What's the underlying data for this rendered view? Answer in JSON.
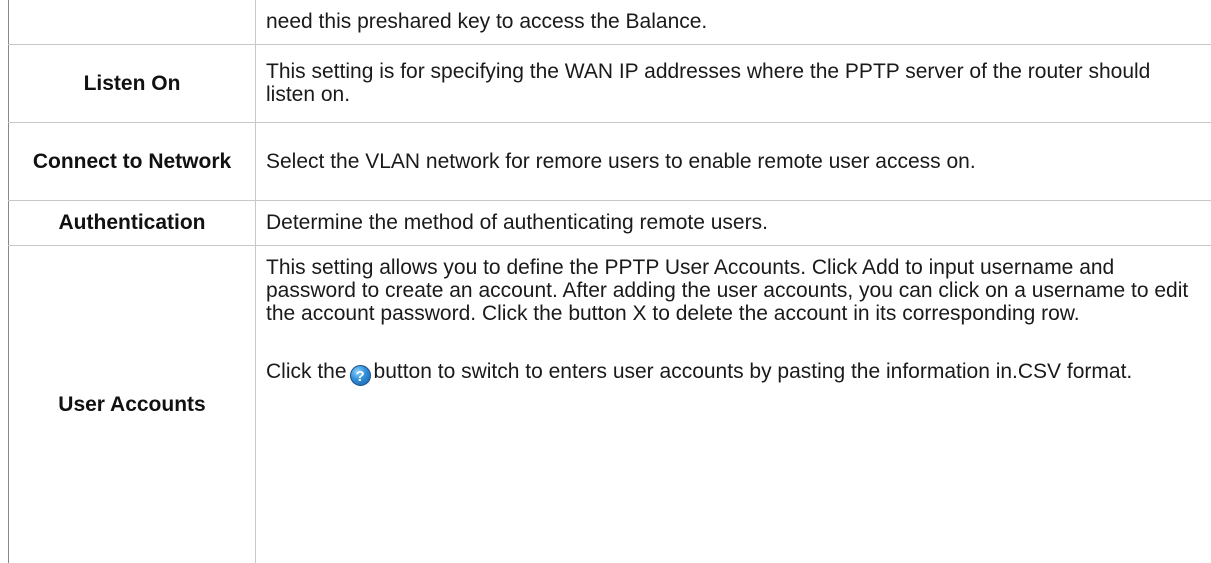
{
  "rows": [
    {
      "label": "",
      "description": "need this preshared key to access the Balance."
    },
    {
      "label": "Listen On",
      "description": "This setting is for specifying the WAN IP addresses where the PPTP server of the router should listen on."
    },
    {
      "label": "Connect to Network",
      "description": "Select the VLAN network for remore users to enable remote user access on."
    },
    {
      "label": "Authentication",
      "description": "Determine the method of authenticating remote users."
    },
    {
      "label": "User Accounts",
      "description": "This setting allows you to define the PPTP User Accounts. Click Add to input username and password to create an account. After adding the user accounts, you can click on a username to edit the account password. Click the button X to delete the account in its corresponding row.",
      "description_2_before": "Click the",
      "description_2_after": "button to switch to enters user accounts by pasting the information in.CSV format."
    }
  ],
  "icons": {
    "help_icon": "question-mark-circle-icon",
    "help_icon_glyph": "?"
  },
  "colors": {
    "help_icon_blue": "#2f8fd8",
    "border": "#c8c8c8"
  }
}
